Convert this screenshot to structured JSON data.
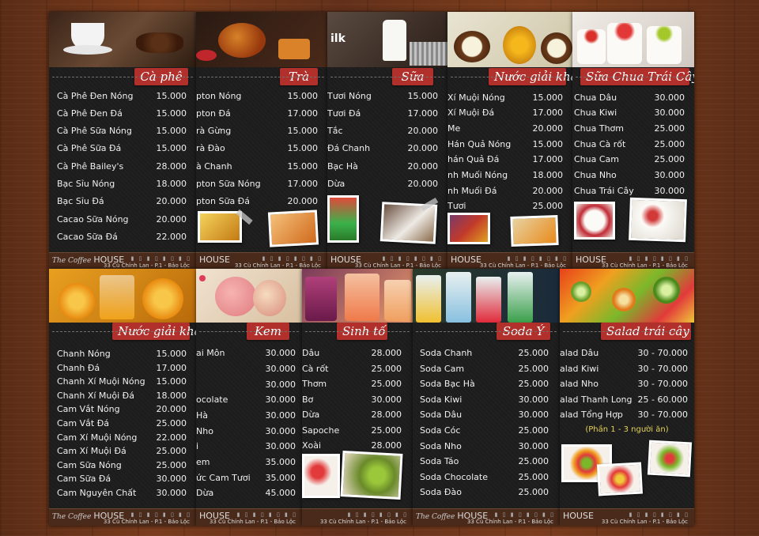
{
  "panels": [
    {
      "id": "ca-phe",
      "title": "Cà phê",
      "items": [
        {
          "name": "Cà Phê Đen Nóng",
          "price": "15.000"
        },
        {
          "name": "Cà Phê Đen Đá",
          "price": "15.000"
        },
        {
          "name": "Cà Phê Sữa Nóng",
          "price": "15.000"
        },
        {
          "name": "Cà Phê Sữa Đá",
          "price": "15.000"
        },
        {
          "name": "Cà Phê Bailey's",
          "price": "28.000"
        },
        {
          "name": "Bạc Sỉu Nóng",
          "price": "18.000"
        },
        {
          "name": "Bạc Sỉu Đá",
          "price": "20.000"
        },
        {
          "name": "Cacao Sữa Nóng",
          "price": "20.000"
        },
        {
          "name": "Cacao Sữa Đá",
          "price": "22.000"
        }
      ]
    },
    {
      "id": "tra",
      "title": "Trà",
      "items": [
        {
          "name": "pton Nóng",
          "price": "15.000"
        },
        {
          "name": "pton Đá",
          "price": "17.000"
        },
        {
          "name": "rà Gừng",
          "price": "15.000"
        },
        {
          "name": "rà Đào",
          "price": "15.000"
        },
        {
          "name": "à Chanh",
          "price": "15.000"
        },
        {
          "name": "pton Sữa Nóng",
          "price": "17.000"
        },
        {
          "name": "pton Sữa Đá",
          "price": "20.000"
        }
      ]
    },
    {
      "id": "sua",
      "title": "Sữa",
      "photo_text": "ilk",
      "items": [
        {
          "name": "Tươi Nóng",
          "price": "15.000"
        },
        {
          "name": "Tươi Đá",
          "price": "17.000"
        },
        {
          "name": "Tắc",
          "price": "20.000"
        },
        {
          "name": "Đá Chanh",
          "price": "20.000"
        },
        {
          "name": "Bạc Hà",
          "price": "20.000"
        },
        {
          "name": "Dừa",
          "price": "20.000"
        }
      ]
    },
    {
      "id": "nuoc-giai-khat-1",
      "title": "Nước giải khát",
      "items": [
        {
          "name": "Xí Muội Nóng",
          "price": "15.000"
        },
        {
          "name": "Xí Muội Đá",
          "price": "17.000"
        },
        {
          "name": "Me",
          "price": "20.000"
        },
        {
          "name": "Hán Quả Nóng",
          "price": "15.000"
        },
        {
          "name": "hán Quả Đá",
          "price": "17.000"
        },
        {
          "name": "nh Muối Nóng",
          "price": "18.000"
        },
        {
          "name": "nh Muối Đá",
          "price": "20.000"
        },
        {
          "name": "Tươi",
          "price": "25.000"
        }
      ]
    },
    {
      "id": "sua-chua",
      "title": "Sữa Chua Trái Cây",
      "items": [
        {
          "name": "Chua Dâu",
          "price": "30.000"
        },
        {
          "name": "Chua Kiwi",
          "price": "30.000"
        },
        {
          "name": "Chua Thơm",
          "price": "25.000"
        },
        {
          "name": "Chua Cà rốt",
          "price": "25.000"
        },
        {
          "name": "Chua Cam",
          "price": "25.000"
        },
        {
          "name": "Chua Nho",
          "price": "30.000"
        },
        {
          "name": "Chua Trái Cây",
          "price": "30.000"
        }
      ]
    },
    {
      "id": "nuoc-giai-khat-2",
      "title": "Nước giải khát",
      "items": [
        {
          "name": "Chanh Nóng",
          "price": "15.000"
        },
        {
          "name": "Chanh Đá",
          "price": "17.000"
        },
        {
          "name": "Chanh Xí Muội Nóng",
          "price": "15.000"
        },
        {
          "name": "Chanh Xí Muội Đá",
          "price": "18.000"
        },
        {
          "name": "Cam Vắt Nóng",
          "price": "20.000"
        },
        {
          "name": "Cam Vắt Đá",
          "price": "25.000"
        },
        {
          "name": "Cam Xí Muội Nóng",
          "price": "22.000"
        },
        {
          "name": "Cam Xí Muội Đá",
          "price": "25.000"
        },
        {
          "name": "Cam Sữa Nóng",
          "price": "25.000"
        },
        {
          "name": "Cam Sữa Đá",
          "price": "30.000"
        },
        {
          "name": "Cam Nguyên Chất",
          "price": "30.000"
        }
      ]
    },
    {
      "id": "kem",
      "title": "Kem",
      "items": [
        {
          "name": "ai Môn",
          "price": "30.000"
        },
        {
          "name": "",
          "price": "30.000"
        },
        {
          "name": "",
          "price": "30.000"
        },
        {
          "name": "ocolate",
          "price": "30.000"
        },
        {
          "name": "Hà",
          "price": "30.000"
        },
        {
          "name": "Nho",
          "price": "30.000"
        },
        {
          "name": "i",
          "price": "30.000"
        },
        {
          "name": "em",
          "price": "35.000"
        },
        {
          "name": "ức Cam Tươi",
          "price": "35.000"
        },
        {
          "name": "Dừa",
          "price": "45.000"
        }
      ]
    },
    {
      "id": "sinh-to",
      "title": "Sinh tố",
      "items": [
        {
          "name": "Dâu",
          "price": "28.000"
        },
        {
          "name": "Cà rốt",
          "price": "25.000"
        },
        {
          "name": "Thơm",
          "price": "25.000"
        },
        {
          "name": "Bơ",
          "price": "30.000"
        },
        {
          "name": "Dừa",
          "price": "28.000"
        },
        {
          "name": "Sapoche",
          "price": "25.000"
        },
        {
          "name": "Xoài",
          "price": "28.000"
        }
      ]
    },
    {
      "id": "soda",
      "title": "Soda Ý",
      "items": [
        {
          "name": "Soda Chanh",
          "price": "25.000"
        },
        {
          "name": "Soda Cam",
          "price": "25.000"
        },
        {
          "name": "Soda Bạc Hà",
          "price": "25.000"
        },
        {
          "name": "Soda Kiwi",
          "price": "30.000"
        },
        {
          "name": "Soda Dâu",
          "price": "30.000"
        },
        {
          "name": "Soda Cóc",
          "price": "25.000"
        },
        {
          "name": "Soda Nho",
          "price": "30.000"
        },
        {
          "name": "Soda Táo",
          "price": "25.000"
        },
        {
          "name": "Soda Chocolate",
          "price": "25.000"
        },
        {
          "name": "Soda Đào",
          "price": "25.000"
        }
      ]
    },
    {
      "id": "salad",
      "title": "Salad trái cây",
      "note": "(Phần 1 - 3 người ăn)",
      "items": [
        {
          "name": "alad Dâu",
          "price": "30 - 70.000"
        },
        {
          "name": "alad Kiwi",
          "price": "30 - 70.000"
        },
        {
          "name": "alad Nho",
          "price": "30 - 70.000"
        },
        {
          "name": "alad Thanh Long",
          "price": "25 - 60.000"
        },
        {
          "name": "alad Tổng Hợp",
          "price": "30 - 70.000"
        }
      ]
    }
  ],
  "footer": {
    "brand_script": "The Coffee",
    "brand": "HOUSE",
    "address": "33 Cù Chính Lan - P.1 - Bảo Lộc",
    "cups": "▮ ▯ ▮ ▯ ▮ ▯ ▮ ▯"
  },
  "colors": {
    "ribbon": "#b1302c",
    "board": "#1d1d1d",
    "wood": "#6b3419",
    "note": "#e5d25a"
  }
}
